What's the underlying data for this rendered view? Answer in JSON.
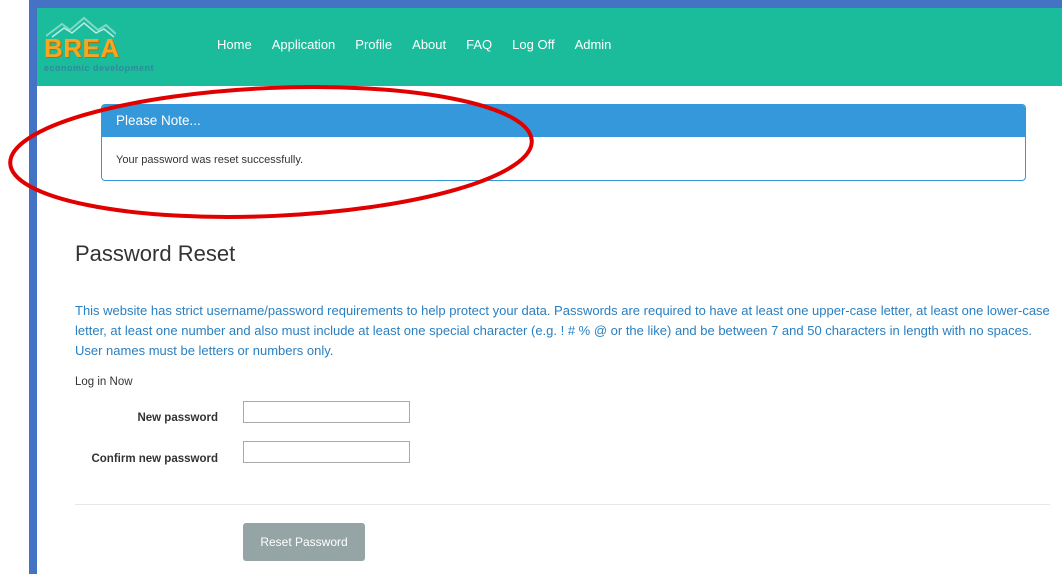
{
  "brand": {
    "name": "BREA",
    "tagline": "economic development",
    "name_color": "#f5a623",
    "tagline_color": "#2e8b9a"
  },
  "nav": {
    "items": [
      "Home",
      "Application",
      "Profile",
      "About",
      "FAQ",
      "Log Off",
      "Admin"
    ],
    "background": "#1abc9c"
  },
  "note": {
    "heading": "Please Note...",
    "message": "Your password was reset successfully.",
    "accent": "#3498db"
  },
  "page": {
    "title": "Password Reset",
    "requirements": "This website has strict username/password requirements to help protect your data. Passwords are required to have at least one upper-case letter, at least one lower-case letter, at least one number and also must include at least one special character (e.g. ! # % @ or the like) and be between 7 and 50 characters in length with no spaces. User names must be letters or numbers only.",
    "login_now": "Log in Now"
  },
  "form": {
    "new_password_label": "New password",
    "new_password_value": "",
    "confirm_password_label": "Confirm new password",
    "confirm_password_value": "",
    "submit_label": "Reset Password"
  },
  "annotation": {
    "shape": "ellipse",
    "color": "#e00000"
  }
}
